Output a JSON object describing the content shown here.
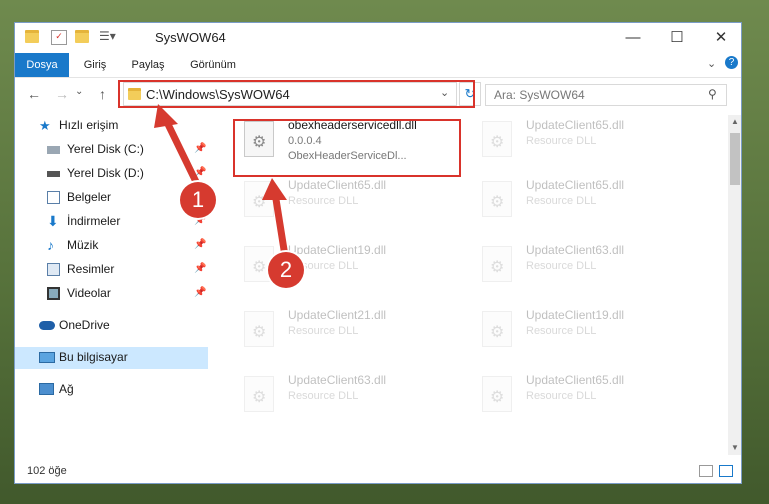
{
  "window": {
    "title": "SysWOW64",
    "controls": [
      "—",
      "☐",
      "✕"
    ]
  },
  "ribbon": {
    "tabs": [
      "Dosya",
      "Giriş",
      "Paylaş",
      "Görünüm"
    ]
  },
  "address": {
    "path": "C:\\Windows\\SysWOW64",
    "search_placeholder": "Ara: SysWOW64"
  },
  "sidebar": {
    "items": [
      {
        "label": "Hızlı erişim"
      },
      {
        "label": "Yerel Disk (C:)"
      },
      {
        "label": "Yerel Disk (D:)"
      },
      {
        "label": "Belgeler"
      },
      {
        "label": "İndirmeler"
      },
      {
        "label": "Müzik"
      },
      {
        "label": "Resimler"
      },
      {
        "label": "Videolar"
      },
      {
        "label": "OneDrive"
      },
      {
        "label": "Bu bilgisayar"
      },
      {
        "label": "Ağ"
      }
    ]
  },
  "files": [
    {
      "name": "obexheaderservicedll.dll",
      "line2": "0.0.0.4",
      "line3": "ObexHeaderServiceDl..."
    },
    {
      "name": "UpdateClient65.dll",
      "line2": "Resource DLL"
    },
    {
      "name": "UpdateClient65.dll",
      "line2": "Resource DLL"
    },
    {
      "name": "UpdateClient65.dll",
      "line2": "Resource DLL"
    },
    {
      "name": "UpdateClient19.dll",
      "line2": "Resource DLL"
    },
    {
      "name": "UpdateClient63.dll",
      "line2": "Resource DLL"
    },
    {
      "name": "UpdateClient21.dll",
      "line2": "Resource DLL"
    },
    {
      "name": "UpdateClient19.dll",
      "line2": "Resource DLL"
    },
    {
      "name": "UpdateClient63.dll",
      "line2": "Resource DLL"
    },
    {
      "name": "UpdateClient65.dll",
      "line2": "Resource DLL"
    }
  ],
  "status": {
    "count": "102 öğe"
  },
  "annotations": {
    "badge1": "1",
    "badge2": "2"
  },
  "colors": {
    "accent": "#1979ca",
    "highlight": "#d9332b",
    "selection": "#cce8ff"
  }
}
